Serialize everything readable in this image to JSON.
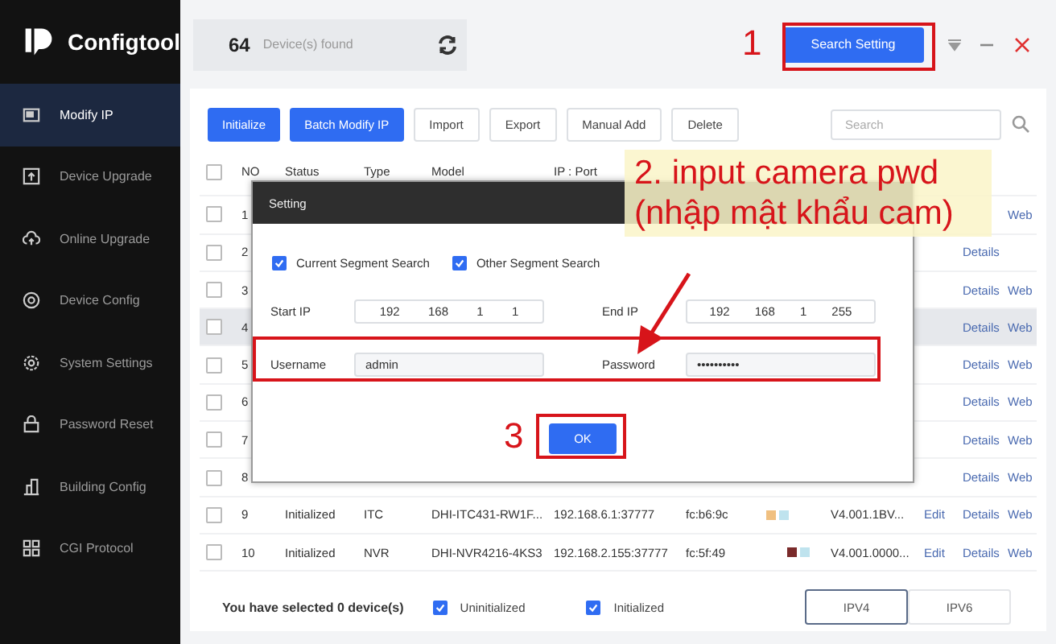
{
  "app": {
    "name": "Configtool"
  },
  "sidebar": {
    "items": [
      {
        "label": "Modify IP",
        "kind": "monitor",
        "selected": true
      },
      {
        "label": "Device Upgrade",
        "kind": "upload",
        "selected": false
      },
      {
        "label": "Online Upgrade",
        "kind": "cloud",
        "selected": false
      },
      {
        "label": "Device Config",
        "kind": "target",
        "selected": false
      },
      {
        "label": "System Settings",
        "kind": "gear",
        "selected": false
      },
      {
        "label": "Password Reset",
        "kind": "lock",
        "selected": false
      },
      {
        "label": "Building Config",
        "kind": "building",
        "selected": false
      },
      {
        "label": "CGI Protocol",
        "kind": "grid",
        "selected": false
      }
    ]
  },
  "header": {
    "count": "64",
    "count_label": "Device(s) found",
    "search_button": "Search Setting"
  },
  "toolbar": {
    "buttons": [
      {
        "label": "Initialize",
        "kind": "primary"
      },
      {
        "label": "Batch Modify IP",
        "kind": "primary"
      },
      {
        "label": "Import",
        "kind": "plain"
      },
      {
        "label": "Export",
        "kind": "plain"
      },
      {
        "label": "Manual Add",
        "kind": "plain"
      },
      {
        "label": "Delete",
        "kind": "plain"
      }
    ],
    "search": {
      "placeholder": "Search"
    }
  },
  "table": {
    "select_all": {
      "checked": false
    },
    "columns": [
      "NO",
      "Status",
      "Type",
      "Model",
      "IP : Port"
    ],
    "rows": [
      {
        "no": "1",
        "checked": false,
        "selected": false,
        "links": [
          {
            "label": "Web",
            "kind": "web"
          }
        ]
      },
      {
        "no": "2",
        "checked": false,
        "selected": false,
        "links": [
          {
            "label": "Details",
            "kind": "details"
          }
        ]
      },
      {
        "no": "3",
        "checked": false,
        "selected": false,
        "links": [
          {
            "label": "Details",
            "kind": "details"
          },
          {
            "label": "Web",
            "kind": "web"
          }
        ]
      },
      {
        "no": "4",
        "checked": false,
        "selected": true,
        "links": [
          {
            "label": "Details",
            "kind": "details"
          },
          {
            "label": "Web",
            "kind": "web"
          }
        ]
      },
      {
        "no": "5",
        "checked": false,
        "selected": false,
        "links": [
          {
            "label": "Details",
            "kind": "details"
          },
          {
            "label": "Web",
            "kind": "web"
          }
        ]
      },
      {
        "no": "6",
        "checked": false,
        "selected": false,
        "links": [
          {
            "label": "Details",
            "kind": "details"
          },
          {
            "label": "Web",
            "kind": "web"
          }
        ]
      },
      {
        "no": "7",
        "checked": false,
        "selected": false,
        "links": [
          {
            "label": "Details",
            "kind": "details"
          },
          {
            "label": "Web",
            "kind": "web"
          }
        ]
      },
      {
        "no": "8",
        "checked": false,
        "selected": false,
        "links": [
          {
            "label": "Details",
            "kind": "details"
          },
          {
            "label": "Web",
            "kind": "web"
          }
        ]
      },
      {
        "no": "9",
        "checked": false,
        "selected": false,
        "status": "Initialized",
        "type": "ITC",
        "model": "DHI-ITC431-RW1F...",
        "ip": "192.168.6.1:37777",
        "mac": "fc:b6:9c",
        "version": "V4.001.1BV...",
        "links": [
          {
            "label": "Edit",
            "kind": "edit"
          },
          {
            "label": "Details",
            "kind": "details"
          },
          {
            "label": "Web",
            "kind": "web"
          }
        ]
      },
      {
        "no": "10",
        "checked": false,
        "selected": false,
        "status": "Initialized",
        "type": "NVR",
        "model": "DHI-NVR4216-4KS3",
        "ip": "192.168.2.155:37777",
        "mac": "fc:5f:49",
        "version": "V4.001.0000...",
        "links": [
          {
            "label": "Edit",
            "kind": "edit"
          },
          {
            "label": "Details",
            "kind": "details"
          },
          {
            "label": "Web",
            "kind": "web"
          }
        ]
      }
    ]
  },
  "footer": {
    "selected_text": "You have selected 0  device(s)",
    "filters": [
      {
        "label": "Uninitialized",
        "checked": true
      },
      {
        "label": "Initialized",
        "checked": true
      }
    ],
    "ip_tabs": [
      {
        "label": "IPV4",
        "selected": true
      },
      {
        "label": "IPV6",
        "selected": false
      }
    ]
  },
  "dialog": {
    "title": "Setting",
    "options": [
      {
        "label": "Current Segment Search",
        "checked": true
      },
      {
        "label": "Other Segment Search",
        "checked": true
      }
    ],
    "start_ip_label": "Start  IP",
    "start_ip": [
      "192",
      "168",
      "1",
      "1"
    ],
    "end_ip_label": "End IP",
    "end_ip": [
      "192",
      "168",
      "1",
      "255"
    ],
    "username_label": "Username",
    "username": "admin",
    "password_label": "Password",
    "password": "••••••••••",
    "ok": "OK"
  },
  "annotations": {
    "step1": "1",
    "step2_lines": [
      "2. input camera pwd",
      "(nhập mật khẩu cam)"
    ],
    "step3": "3"
  }
}
